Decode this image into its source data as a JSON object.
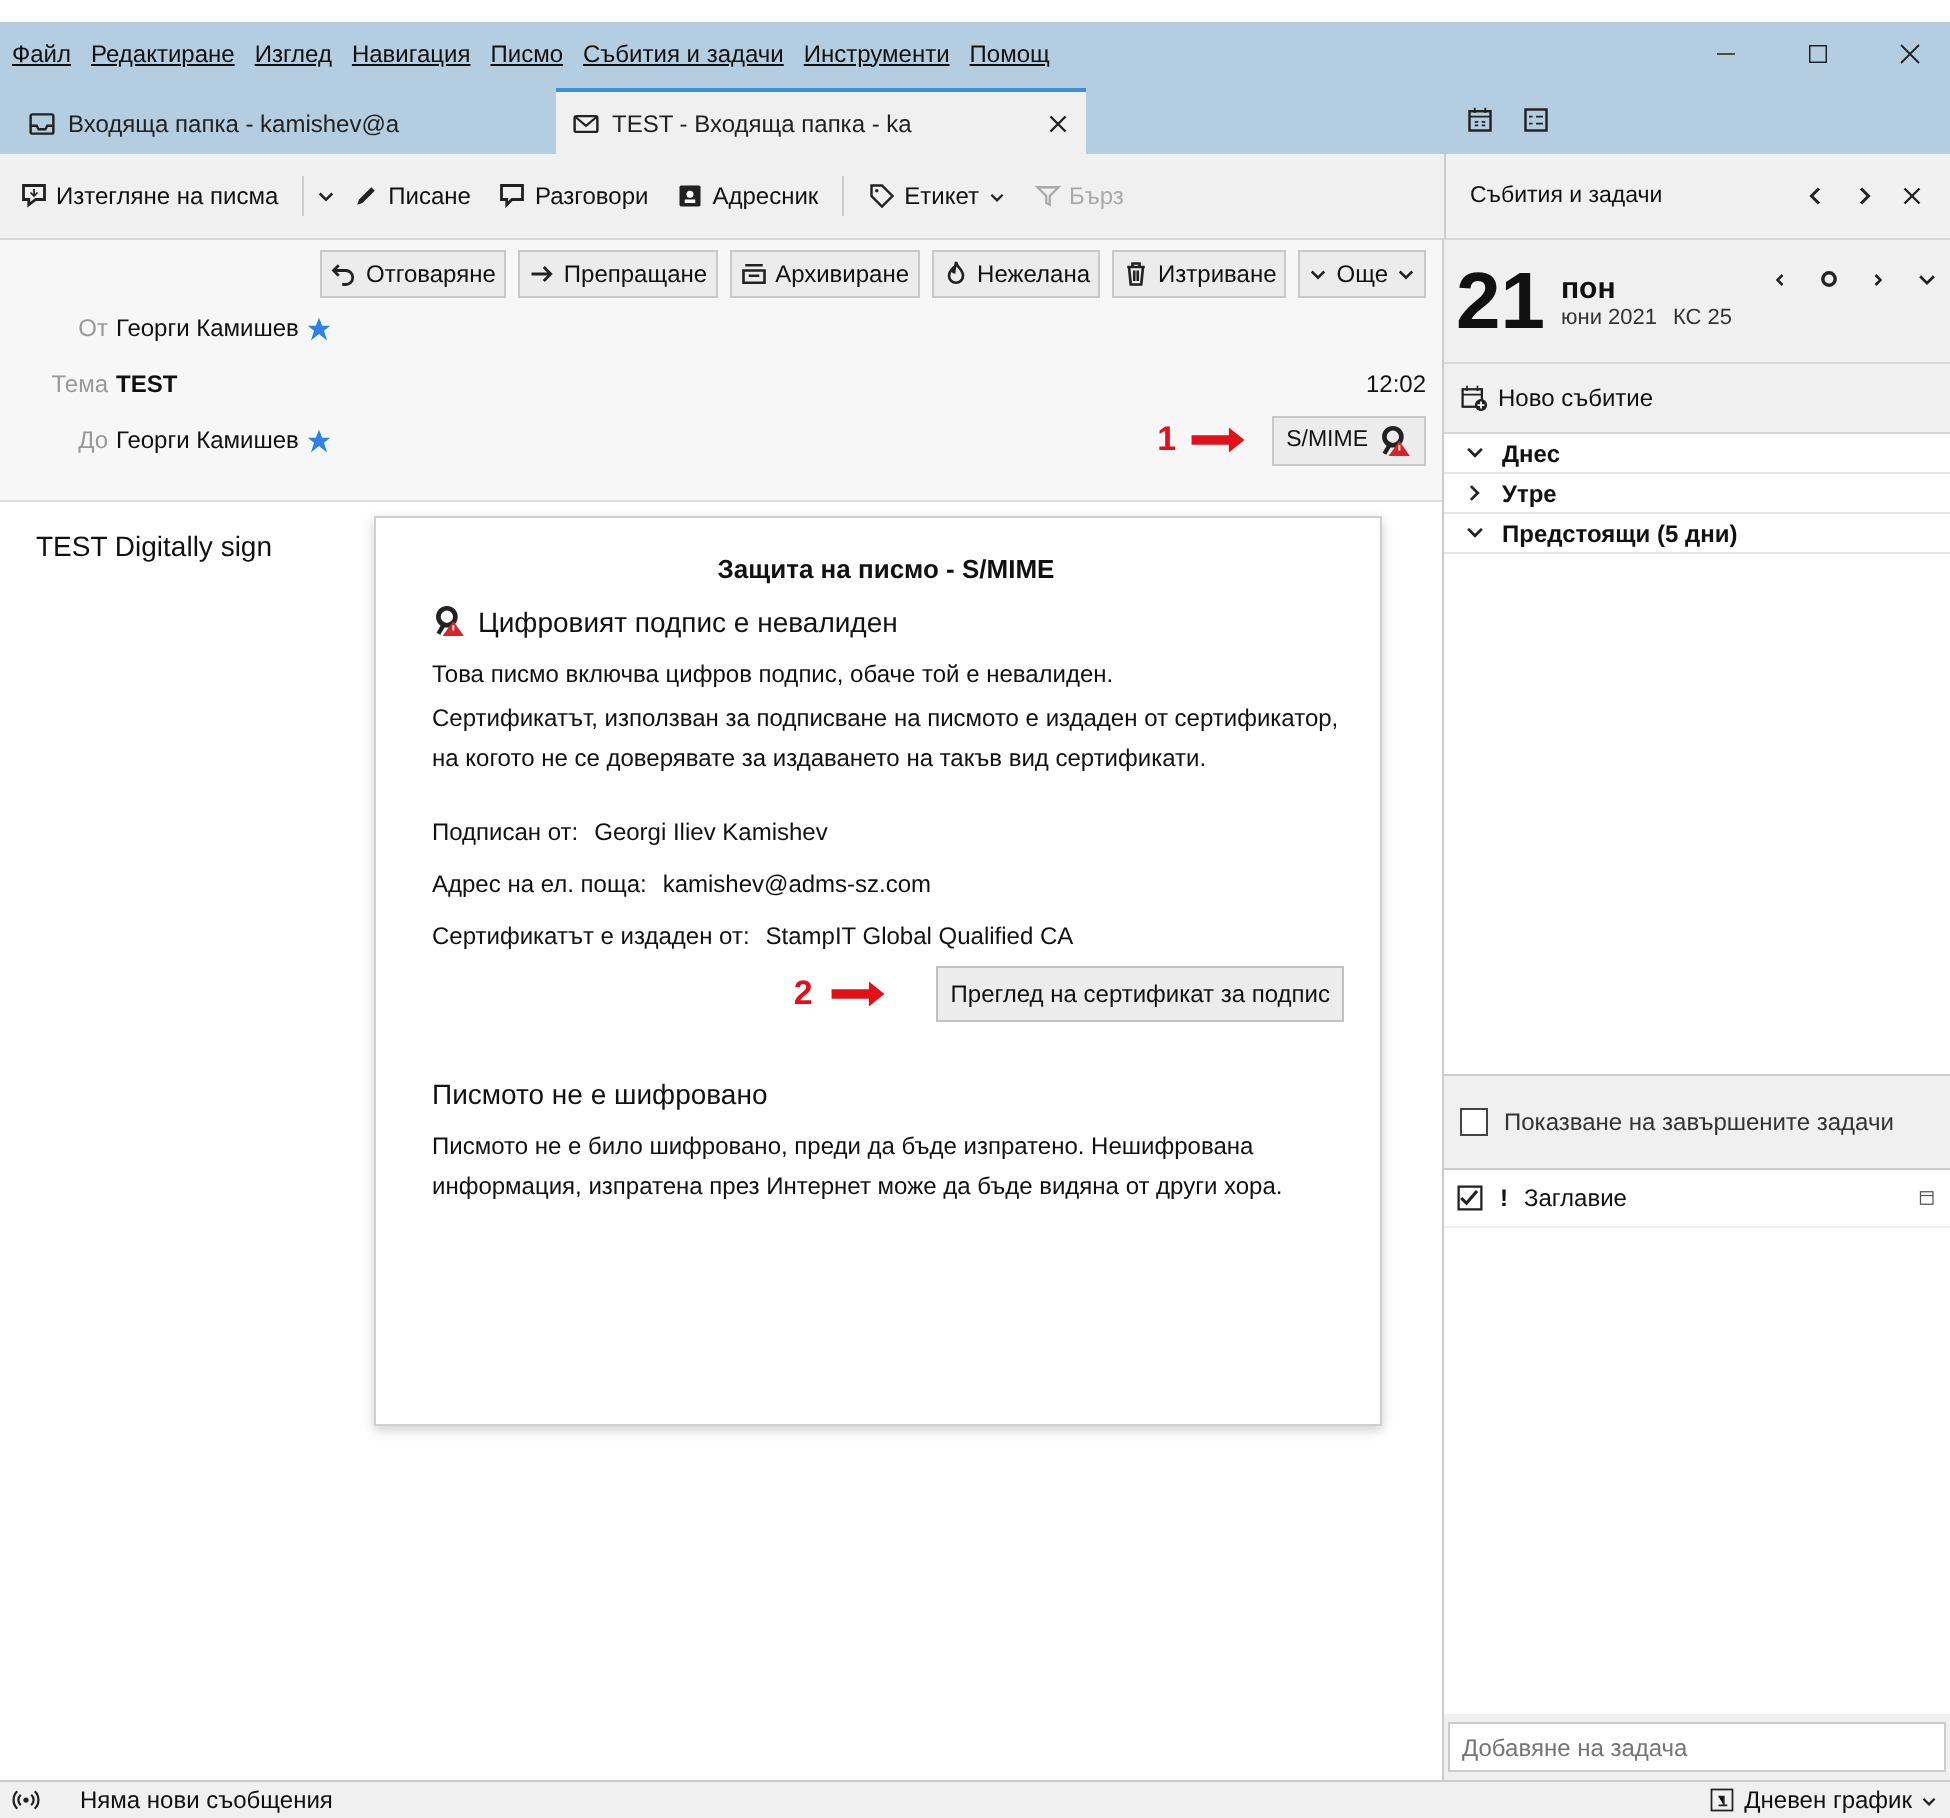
{
  "menu_bar": {
    "items": [
      "Файл",
      "Редактиране",
      "Изглед",
      "Навигация",
      "Писмо",
      "Събития и задачи",
      "Инструменти",
      "Помощ"
    ]
  },
  "tabs": [
    {
      "kind": "folder",
      "label": "Входяща папка - kamishev@a",
      "selected": false
    },
    {
      "kind": "mail",
      "label": "TEST - Входяща папка - ka",
      "selected": true
    }
  ],
  "toolbar": {
    "items": [
      {
        "kind": "get",
        "label": "Изтегляне на писма",
        "disabled": false
      },
      {
        "kind": "write",
        "label": "Писане",
        "disabled": false
      },
      {
        "kind": "chat",
        "label": "Разговори",
        "disabled": false
      },
      {
        "kind": "address",
        "label": "Адресник",
        "disabled": false
      },
      {
        "kind": "tag",
        "label": "Етикет",
        "disabled": false
      },
      {
        "kind": "filter",
        "label": "Бърз",
        "disabled": true
      }
    ],
    "side_title": "Събития и задачи"
  },
  "message": {
    "actions": [
      {
        "kind": "reply",
        "label": "Отговаряне"
      },
      {
        "kind": "forward",
        "label": "Препращане"
      },
      {
        "kind": "archive",
        "label": "Архивиране"
      },
      {
        "kind": "junk",
        "label": "Нежелана"
      },
      {
        "kind": "delete",
        "label": "Изтриване"
      },
      {
        "kind": "more",
        "label": "Още"
      }
    ],
    "from_label": "От",
    "from": "Георги Камишев",
    "subject_label": "Тема",
    "subject": "TEST",
    "time": "12:02",
    "to_label": "До",
    "to": "Георги Камишев",
    "smime_button": "S/MIME",
    "body": "TEST Digitally sign"
  },
  "popup": {
    "title": "Защита на писмо - S/MIME",
    "status": "Цифровият подпис е невалиден",
    "paragraphs": [
      "Това писмо включва цифров подпис, обаче той е невалиден.",
      "Сертификатът, използван за подписване на писмото е издаден от сертификатор, на когото не се доверявате за издаването на такъв вид сертификати."
    ],
    "details": [
      {
        "label": "Подписан от:",
        "value": "Georgi Iliev Kamishev"
      },
      {
        "label": "Адрес на ел. поща:",
        "value": "kamishev@adms-sz.com"
      },
      {
        "label": "Сертификатът е издаден от:",
        "value": "StampIT Global Qualified CA"
      }
    ],
    "button": "Преглед на сертификат за подпис",
    "encryption_title": "Писмото не е шифровано",
    "encryption_text": "Писмото не е било шифровано, преди да бъде изпратено. Нешифрована информация, изпратена през Интернет може да бъде видяна от други хора."
  },
  "annotations": [
    {
      "label": "1"
    },
    {
      "label": "2"
    }
  ],
  "calendar": {
    "day": "21",
    "weekday": "пон",
    "month": "юни 2021",
    "week": "КС 25",
    "new_event": "Ново събитие",
    "agenda": [
      {
        "label": "Днес",
        "expanded": true
      },
      {
        "label": "Утре",
        "expanded": false
      },
      {
        "label": "Предстоящи (5 дни)",
        "expanded": true
      }
    ]
  },
  "tasks": {
    "show_completed": {
      "label": "Показване на завършените задачи",
      "checked": false
    },
    "priority_column": "!",
    "title_column": "Заглавие",
    "add_task": {
      "placeholder": "Добавяне на задача"
    }
  },
  "status_bar": {
    "message": "Няма нови съобщения",
    "today_pane": "Дневен график"
  }
}
